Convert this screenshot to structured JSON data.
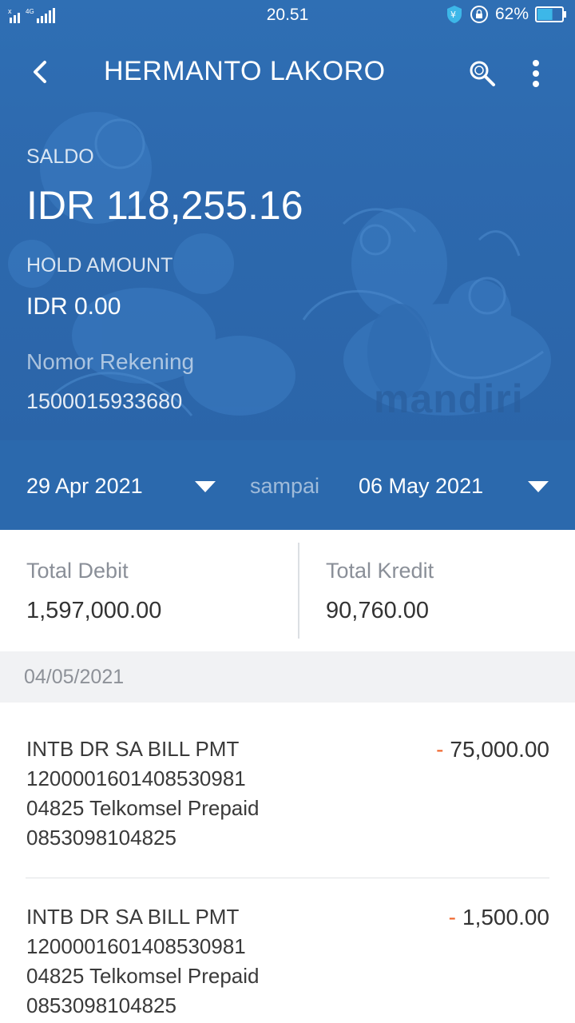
{
  "status_bar": {
    "time": "20.51",
    "battery_percent": "62%",
    "network": "4G",
    "battery_level": 0.62
  },
  "header": {
    "title": "HERMANTO LAKORO"
  },
  "account": {
    "saldo_label": "SALDO",
    "saldo_value": "IDR 118,255.16",
    "hold_label": "HOLD AMOUNT",
    "hold_value": "IDR 0.00",
    "rekening_label": "Nomor Rekening",
    "rekening_value": "1500015933680",
    "brand_watermark": "mandiri"
  },
  "date_range": {
    "from": "29 Apr 2021",
    "separator": "sampai",
    "to": "06 May 2021"
  },
  "totals": {
    "debit_label": "Total Debit",
    "debit_value": "1,597,000.00",
    "kredit_label": "Total Kredit",
    "kredit_value": "90,760.00"
  },
  "transactions_section": {
    "date": "04/05/2021",
    "items": [
      {
        "line1": "INTB DR SA BILL PMT",
        "line2": "120000160140853098​1",
        "line3": "04825 Telkomsel Prepaid",
        "line4": "0853098104825",
        "sign": "-",
        "amount": "75,000.00"
      },
      {
        "line1": "INTB DR SA BILL PMT",
        "line2": "120000160140853098​1",
        "line3": "04825 Telkomsel Prepaid",
        "line4": "0853098104825",
        "sign": "-",
        "amount": "1,500.00"
      }
    ]
  },
  "colors": {
    "primary_blue": "#2d69ae",
    "debit_red": "#f0662d"
  }
}
